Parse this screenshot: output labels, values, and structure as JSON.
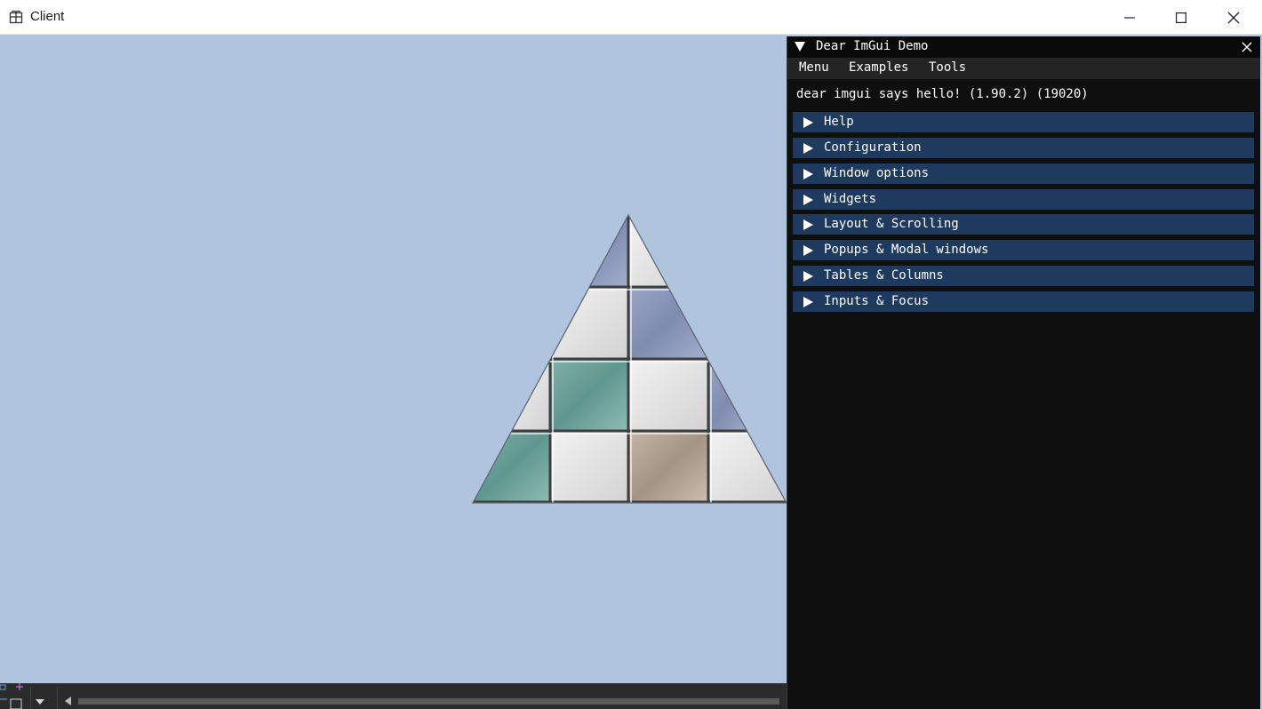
{
  "window": {
    "title": "Client",
    "icon": "package-icon",
    "controls": [
      "minimize-icon",
      "maximize-icon",
      "close-icon"
    ]
  },
  "imgui": {
    "title": "Dear ImGui Demo",
    "menu": [
      "Menu",
      "Examples",
      "Tools"
    ],
    "hello": "dear imgui says hello! (1.90.2) (19020)",
    "headers": [
      "Help",
      "Configuration",
      "Window options",
      "Widgets",
      "Layout & Scrolling",
      "Popups & Modal windows",
      "Tables & Columns",
      "Inputs & Focus"
    ],
    "colors": {
      "header": "#1e3a5f",
      "background": "#0f0f0f",
      "menubar": "#242424"
    }
  },
  "scene": {
    "background": "#b0c4de",
    "object": "tiled pyramid"
  }
}
